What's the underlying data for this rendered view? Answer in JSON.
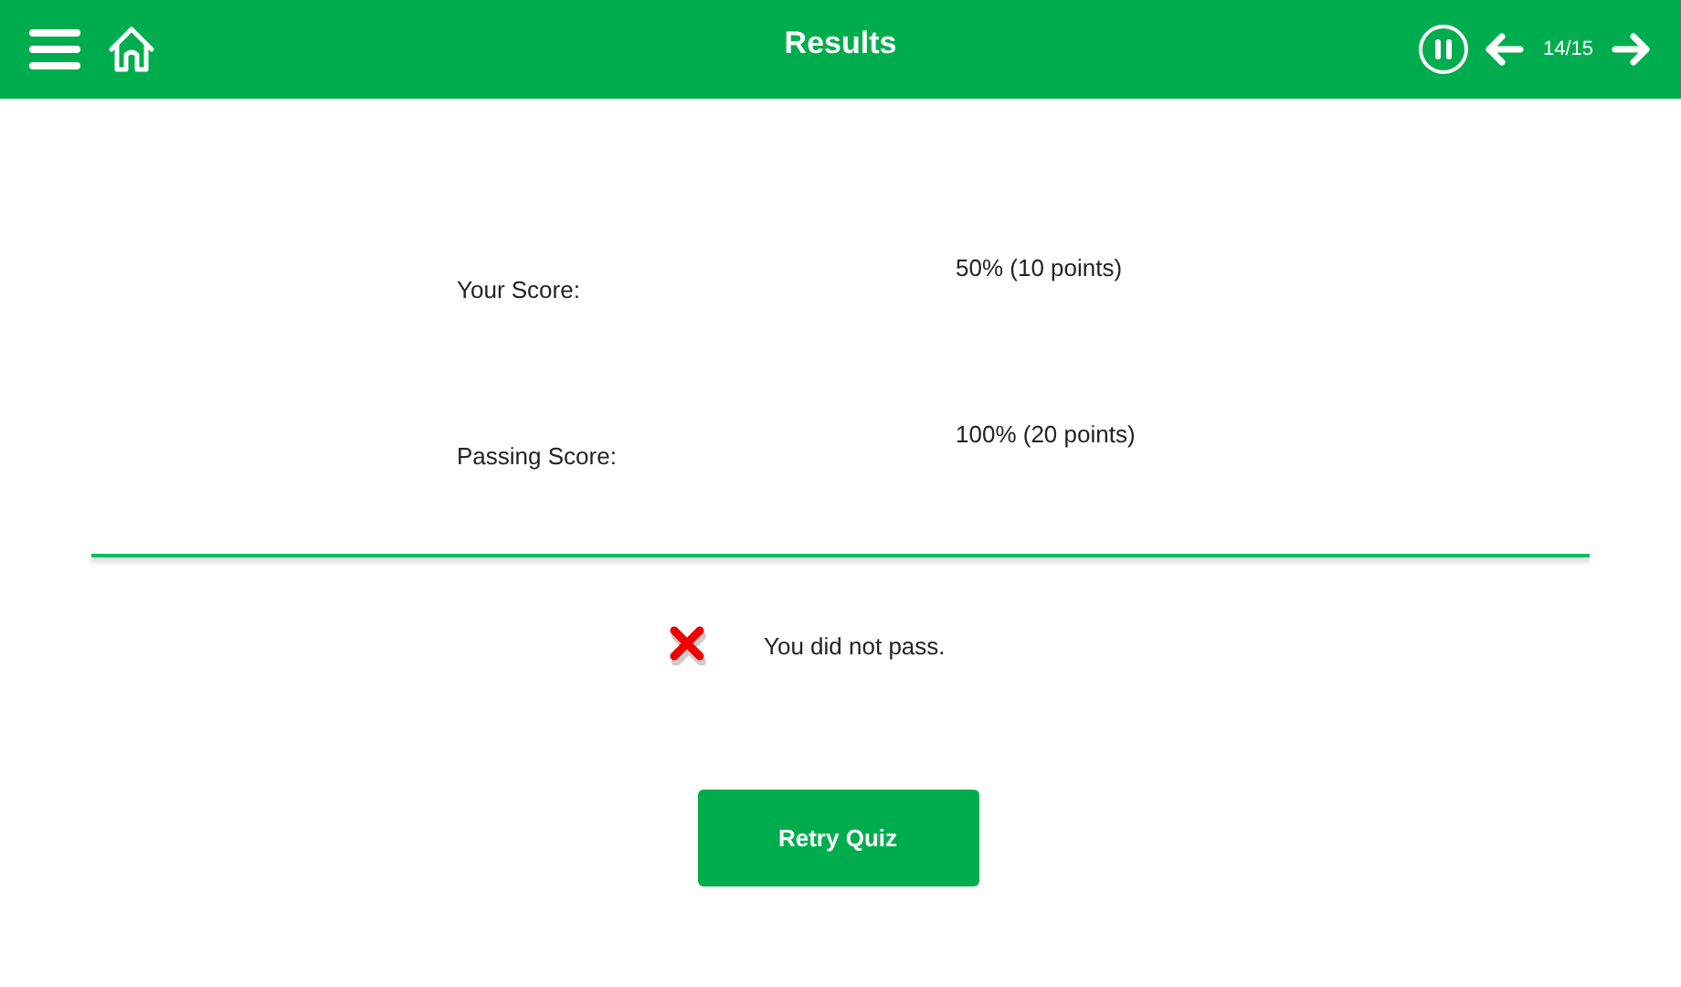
{
  "header": {
    "title": "Results",
    "counter": "14/15"
  },
  "scores": [
    {
      "label": "Your Score:",
      "value": "50% (10 points)"
    },
    {
      "label": "Passing Score:",
      "value": "100% (20 points)"
    }
  ],
  "result": {
    "passed": false,
    "message": "You did not pass."
  },
  "buttons": [
    "Retry Quiz"
  ]
}
